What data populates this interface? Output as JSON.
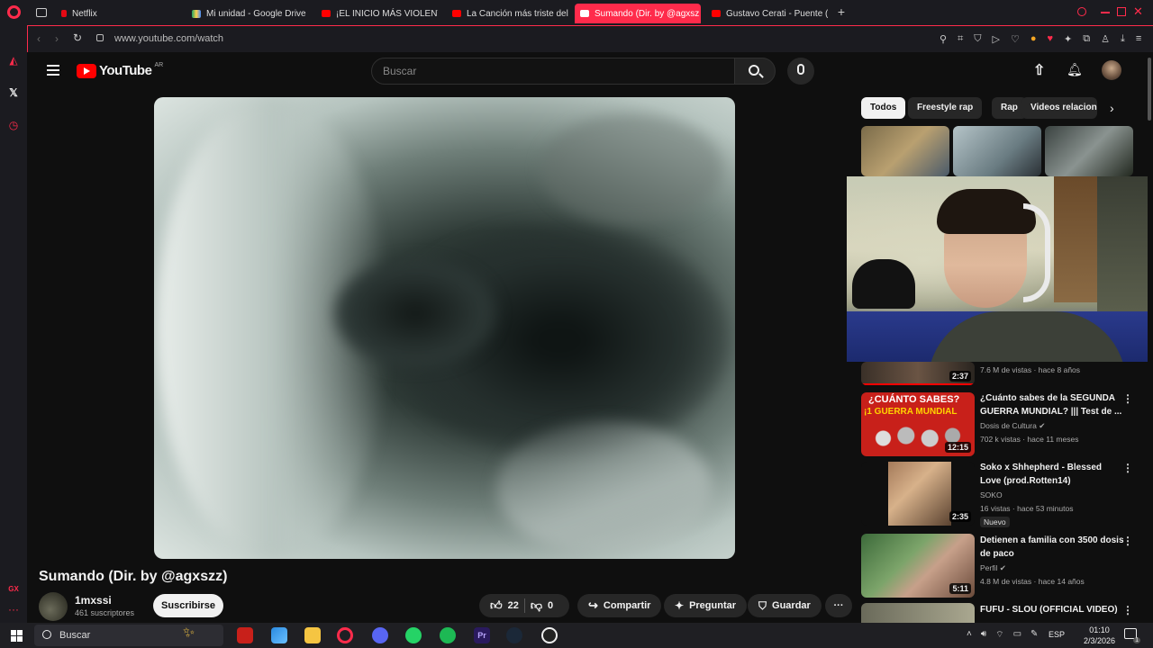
{
  "browser": {
    "tabs": [
      {
        "label": "Netflix",
        "icon": "netflix-icon"
      },
      {
        "label": "Mi unidad - Google Drive",
        "icon": "google-drive-icon"
      },
      {
        "label": "¡EL INICIO MÁS VIOLENTO",
        "icon": "youtube-icon"
      },
      {
        "label": "La Canción más triste del",
        "icon": "youtube-icon"
      },
      {
        "label": "Sumando (Dir. by @agxsz",
        "icon": "youtube-icon",
        "active": true
      },
      {
        "label": "Gustavo Cerati - Puente (C",
        "icon": "youtube-icon"
      }
    ],
    "url": "www.youtube.com/watch",
    "accent": "#ff2b4b"
  },
  "youtube": {
    "logo": "YouTube",
    "region": "AR",
    "search_placeholder": "Buscar",
    "video_title": "Sumando (Dir. by @agxszz)",
    "channel": {
      "name": "1mxssi",
      "subscribers": "461 suscriptores"
    },
    "subscribe_label": "Suscribirse",
    "likes": "22",
    "dislikes": "0",
    "share_label": "Compartir",
    "ask_label": "Preguntar",
    "save_label": "Guardar",
    "chips": [
      "Todos",
      "Freestyle rap",
      "Rap",
      "Videos relacion"
    ],
    "recommendations": [
      {
        "title": "",
        "channel": "",
        "meta": "7.6 M de vistas · hace 8 años",
        "duration": "2:37"
      },
      {
        "title": "¿Cuánto sabes de la SEGUNDA GUERRA MUNDIAL? ||| Test de ...",
        "channel": "Dosis de Cultura",
        "meta": "702 k vistas · hace 11 meses",
        "duration": "12:15",
        "thumb_text_1": "¿CUÁNTO SABES?",
        "thumb_text_2": "¡1 GUERRA MUNDIAL"
      },
      {
        "title": "Soko x Shhepherd - Blessed Love (prod.Rotten14)",
        "channel": "SOKO",
        "meta": "16 vistas · hace 53 minutos",
        "duration": "2:35",
        "badge": "Nuevo"
      },
      {
        "title": "Detienen a familia con 3500 dosis de paco",
        "channel": "Perfil",
        "meta": "4.8 M de vistas · hace 14 años",
        "duration": "5:11"
      },
      {
        "title": "FUFU - SLOU (OFFICIAL VIDEO)",
        "channel": "",
        "meta": "",
        "duration": ""
      }
    ]
  },
  "taskbar": {
    "search_label": "Buscar",
    "language": "ESP",
    "time": "01:10",
    "date": "2/3/2026",
    "notification_count": "1"
  }
}
